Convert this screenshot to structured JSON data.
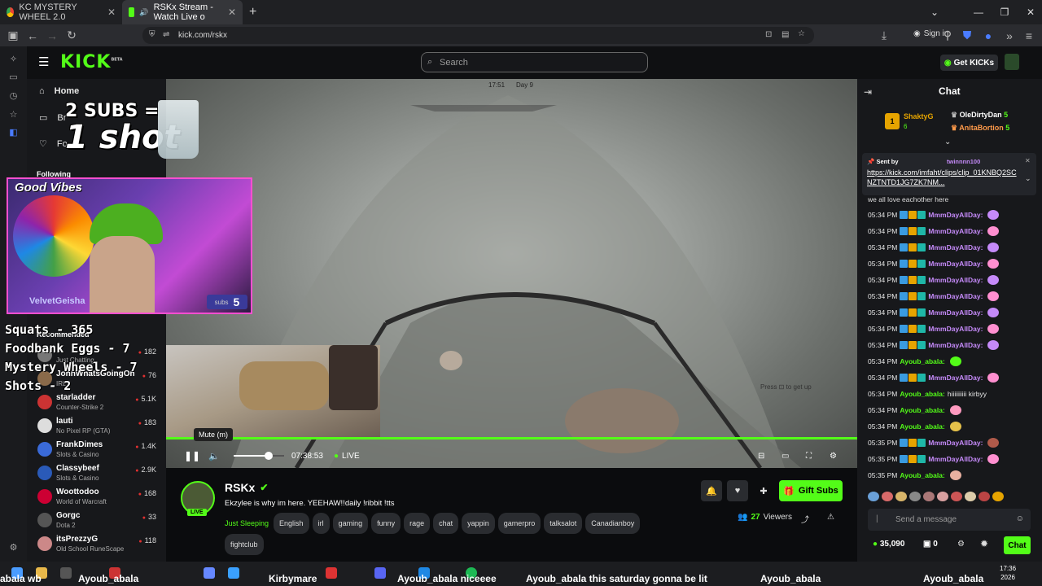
{
  "browser": {
    "tabs": [
      {
        "title": "KC MYSTERY WHEEL 2.0",
        "active": false
      },
      {
        "title": "RSKx Stream - Watch Live o",
        "active": true
      }
    ],
    "url": "kick.com/rskx",
    "sign_in": "Sign in"
  },
  "header": {
    "logo": "KICK",
    "logo_badge": "BETA",
    "search_placeholder": "Search",
    "get_kicks": "Get KICKs"
  },
  "sidebar": {
    "home": "Home",
    "browse": "Br",
    "following_nav": "Fo",
    "following_label": "Following",
    "recommended_label": "Recommended",
    "recommended": [
      {
        "name": "",
        "category": "Just Chatting",
        "viewers": "182"
      },
      {
        "name": "JohnWhatsGoingOn",
        "category": "IRL",
        "viewers": "76"
      },
      {
        "name": "starladder",
        "category": "Counter-Strike 2",
        "viewers": "5.1K"
      },
      {
        "name": "lauti",
        "category": "No Pixel RP (GTA)",
        "viewers": "183"
      },
      {
        "name": "FrankDimes",
        "category": "Slots & Casino",
        "viewers": "1.4K"
      },
      {
        "name": "Classybeef",
        "category": "Slots & Casino",
        "viewers": "2.9K"
      },
      {
        "name": "Woottodoo",
        "category": "World of Warcraft",
        "viewers": "168"
      },
      {
        "name": "Gorgc",
        "category": "Dota 2",
        "viewers": "33"
      },
      {
        "name": "itsPrezzyG",
        "category": "Old School RuneScape",
        "viewers": "118"
      }
    ]
  },
  "overlay": {
    "subs_line1": "2 SUBS =",
    "subs_line2": "1 shot",
    "wheel_title": "Good Vibes",
    "cam_name": "VelvetGeisha",
    "cam_subs_label": "subs",
    "cam_subs_value": "5",
    "stats": [
      "Squats - 365",
      "Foodbank Eggs - 7",
      "Mystery Wheels - 7",
      "Shots - 2"
    ],
    "game_hud": "Press",
    "game_hud_tail": "to get up",
    "game_clock": "17:51",
    "game_day": "Day 9"
  },
  "player": {
    "tooltip": "Mute (m)",
    "elapsed": "07:38:53",
    "live": "LIVE",
    "progress": 1.0,
    "volume": 0.7
  },
  "stream": {
    "channel": "RSKx",
    "title": "Ekzylee is why im here. YEEHAW!!daily !ribbit !tts",
    "category": "Just Sleeping",
    "tags": [
      "English",
      "irl",
      "gaming",
      "funny",
      "rage",
      "chat",
      "yappin",
      "gamerpro",
      "talksalot",
      "Canadianboy",
      "fightclub"
    ],
    "viewers": "27",
    "viewers_label": "Viewers",
    "live_badge": "LIVE",
    "gift_subs": "Gift Subs"
  },
  "chat": {
    "title": "Chat",
    "leaders": [
      {
        "rank": "1",
        "name": "ShaktyG",
        "count": "6"
      },
      {
        "name": "OleDirtyDan",
        "count": "5"
      },
      {
        "name": "AnitaBortion",
        "count": "5"
      }
    ],
    "pinned_sent_by": "Sent by",
    "pinned_user": "twinnnn100",
    "pinned_link": "https://kick.com/imfaht/clips/clip_01KNBQ2SCNZTNTD1JG7ZK7NM...",
    "pinned_prev": "we all love eachother here",
    "messages": [
      {
        "time": "05:34 PM",
        "user": "MmmDayAllDay:",
        "text": "",
        "color": "#c58af9"
      },
      {
        "time": "05:34 PM",
        "user": "MmmDayAllDay:",
        "text": "",
        "color": "#c58af9"
      },
      {
        "time": "05:34 PM",
        "user": "MmmDayAllDay:",
        "text": "",
        "color": "#c58af9"
      },
      {
        "time": "05:34 PM",
        "user": "MmmDayAllDay:",
        "text": "",
        "color": "#c58af9"
      },
      {
        "time": "05:34 PM",
        "user": "MmmDayAllDay:",
        "text": "",
        "color": "#c58af9"
      },
      {
        "time": "05:34 PM",
        "user": "MmmDayAllDay:",
        "text": "",
        "color": "#c58af9"
      },
      {
        "time": "05:34 PM",
        "user": "MmmDayAllDay:",
        "text": "",
        "color": "#c58af9"
      },
      {
        "time": "05:34 PM",
        "user": "MmmDayAllDay:",
        "text": "",
        "color": "#c58af9"
      },
      {
        "time": "05:34 PM",
        "user": "MmmDayAllDay:",
        "text": "",
        "color": "#c58af9"
      },
      {
        "time": "05:34 PM",
        "user": "Ayoub_abala:",
        "text": "",
        "color": "#53fc18"
      },
      {
        "time": "05:34 PM",
        "user": "MmmDayAllDay:",
        "text": "",
        "color": "#c58af9"
      },
      {
        "time": "05:34 PM",
        "user": "Ayoub_abala:",
        "text": "hiiiiiiiiii kirbyy",
        "color": "#53fc18"
      },
      {
        "time": "05:34 PM",
        "user": "Ayoub_abala:",
        "text": "",
        "color": "#53fc18"
      },
      {
        "time": "05:34 PM",
        "user": "Ayoub_abala:",
        "text": "",
        "color": "#53fc18"
      },
      {
        "time": "05:35 PM",
        "user": "MmmDayAllDay:",
        "text": "",
        "color": "#c58af9"
      },
      {
        "time": "05:35 PM",
        "user": "MmmDayAllDay:",
        "text": "",
        "color": "#c58af9"
      },
      {
        "time": "05:35 PM",
        "user": "Ayoub_abala:",
        "text": "",
        "color": "#53fc18"
      }
    ],
    "send_placeholder": "Send a message",
    "points": "35,090",
    "gifts": "0",
    "chat_button": "Chat"
  },
  "taskbar": {
    "ticker": [
      "abala wb",
      "Ayoub_abala",
      "Kirbymare",
      "Ayoub_abala niceeee",
      "Ayoub_abala this saturday gonna be lit",
      "Ayoub_abala",
      "Ayoub_abala"
    ],
    "clock_time": "17:36",
    "clock_date": "2026"
  },
  "colors": {
    "accent": "#53fc18",
    "bg": "#0b0c0e",
    "panel": "#17181b"
  }
}
